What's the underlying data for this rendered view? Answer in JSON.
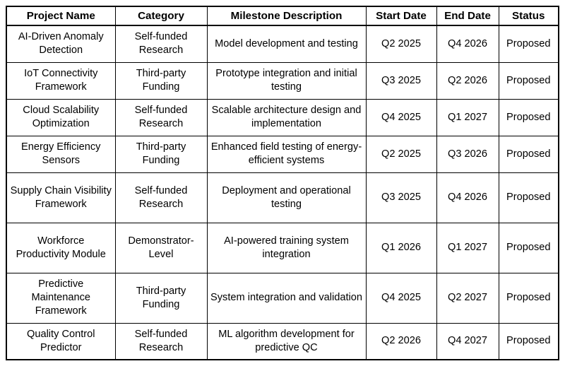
{
  "table": {
    "name": "project-milestones-table",
    "columns": [
      {
        "key": "project_name",
        "label": "Project Name"
      },
      {
        "key": "category",
        "label": "Category"
      },
      {
        "key": "milestone_description",
        "label": "Milestone Description"
      },
      {
        "key": "start_date",
        "label": "Start Date"
      },
      {
        "key": "end_date",
        "label": "End Date"
      },
      {
        "key": "status",
        "label": "Status"
      }
    ],
    "rows": [
      {
        "project_name": "AI-Driven Anomaly Detection",
        "category": "Self-funded Research",
        "milestone_description": "Model development and testing",
        "start_date": "Q2 2025",
        "end_date": "Q4 2026",
        "status": "Proposed",
        "height_class": "r-h2"
      },
      {
        "project_name": "IoT Connectivity Framework",
        "category": "Third-party Funding",
        "milestone_description": "Prototype integration and initial testing",
        "start_date": "Q3 2025",
        "end_date": "Q2 2026",
        "status": "Proposed",
        "height_class": "r-h2"
      },
      {
        "project_name": "Cloud Scalability Optimization",
        "category": "Self-funded Research",
        "milestone_description": "Scalable architecture design and implementation",
        "start_date": "Q4 2025",
        "end_date": "Q1 2027",
        "status": "Proposed",
        "height_class": "r-h2"
      },
      {
        "project_name": "Energy Efficiency Sensors",
        "category": "Third-party Funding",
        "milestone_description": "Enhanced field testing of energy-efficient systems",
        "start_date": "Q2 2025",
        "end_date": "Q3 2026",
        "status": "Proposed",
        "height_class": "r-h2"
      },
      {
        "project_name": "Supply Chain Visibility Framework",
        "category": "Self-funded Research",
        "milestone_description": "Deployment and operational testing",
        "start_date": "Q3 2025",
        "end_date": "Q4 2026",
        "status": "Proposed",
        "height_class": "r-h3"
      },
      {
        "project_name": "Workforce Productivity Module",
        "category": "Demonstrator-Level",
        "milestone_description": "AI-powered training system integration",
        "start_date": "Q1 2026",
        "end_date": "Q1 2027",
        "status": "Proposed",
        "height_class": "r-h3"
      },
      {
        "project_name": "Predictive Maintenance Framework",
        "category": "Third-party Funding",
        "milestone_description": "System integration and validation",
        "start_date": "Q4 2025",
        "end_date": "Q2 2027",
        "status": "Proposed",
        "height_class": "r-h3"
      },
      {
        "project_name": "Quality Control Predictor",
        "category": "Self-funded Research",
        "milestone_description": "ML algorithm development for predictive QC",
        "start_date": "Q2 2026",
        "end_date": "Q4 2027",
        "status": "Proposed",
        "height_class": "r-h2"
      }
    ]
  },
  "colors": {
    "border": "#000000",
    "text": "#000000",
    "background": "#ffffff"
  }
}
